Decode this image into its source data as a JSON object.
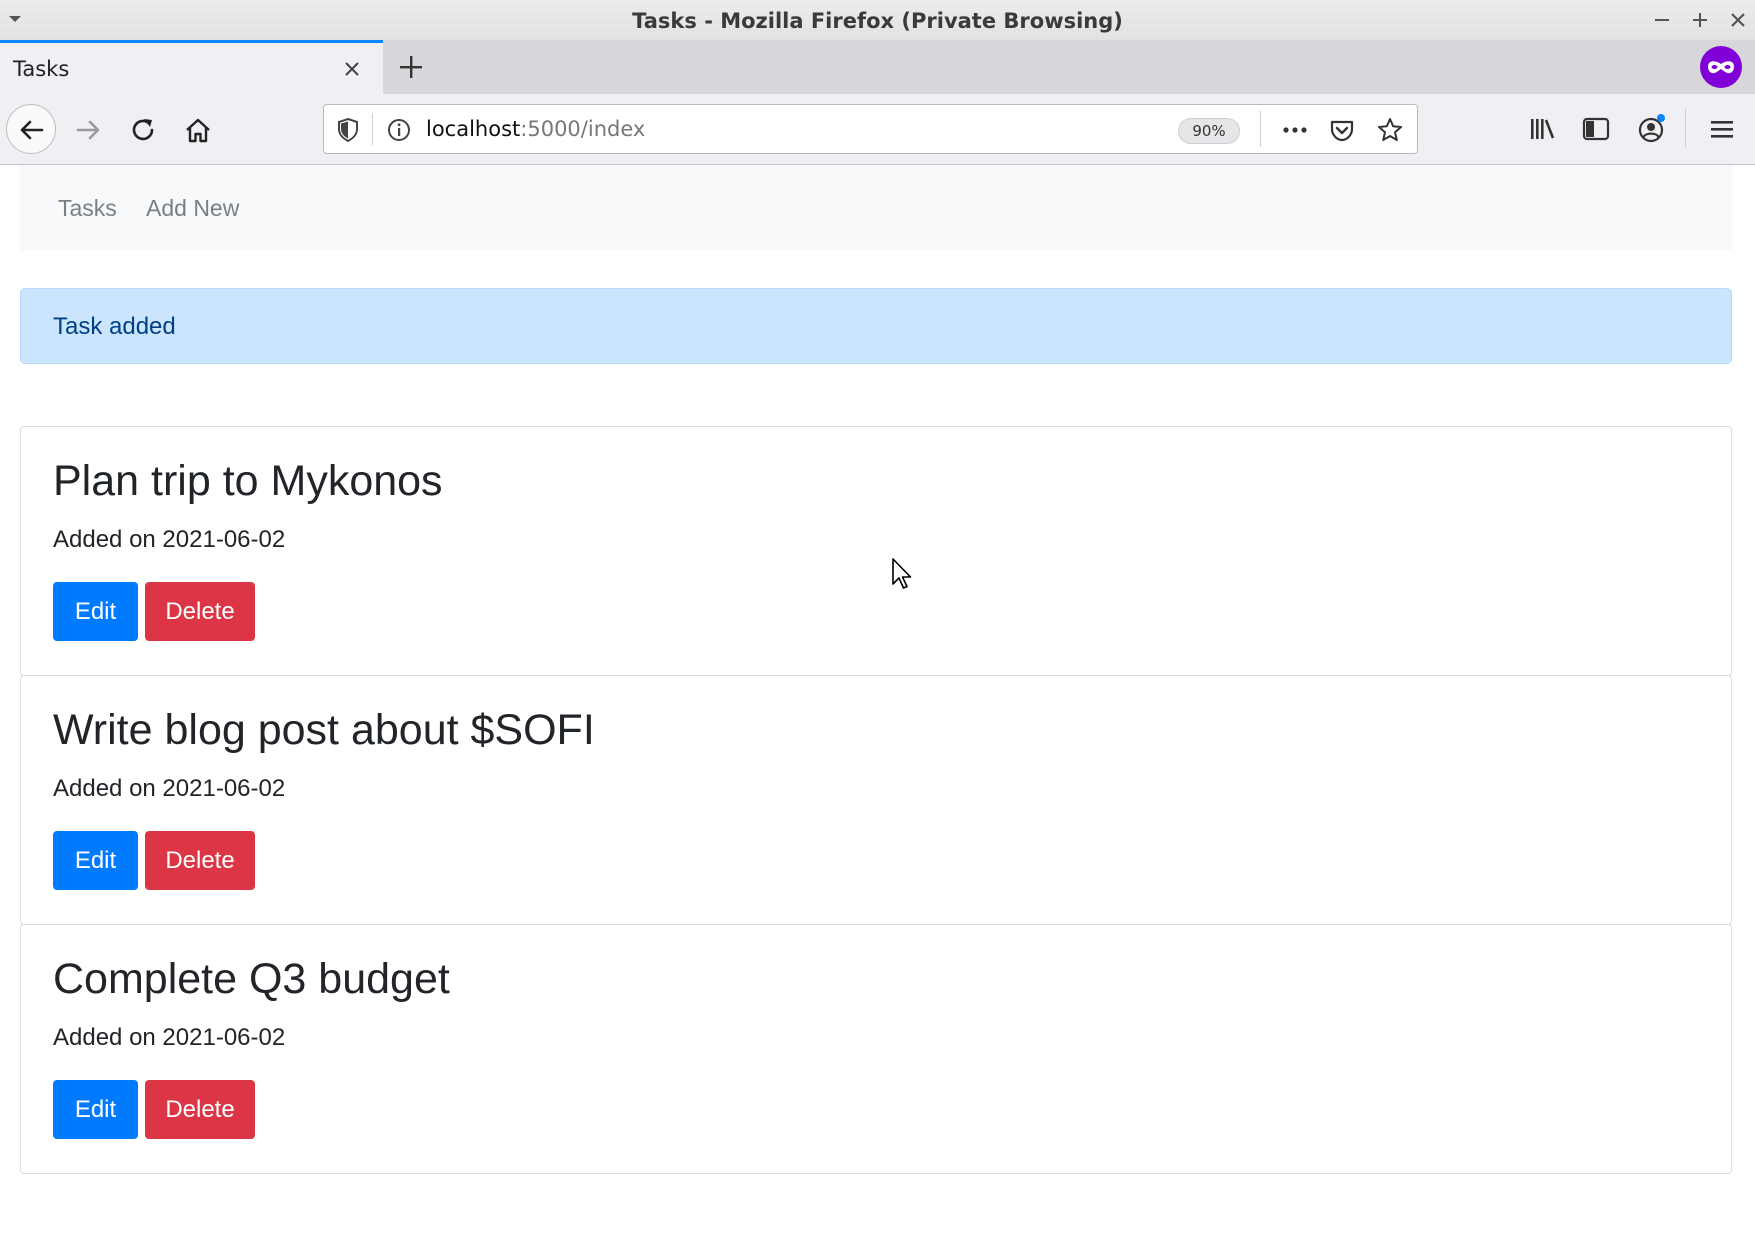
{
  "window": {
    "title": "Tasks - Mozilla Firefox (Private Browsing)"
  },
  "browser": {
    "tab_title": "Tasks",
    "url_host": "localhost",
    "url_path": ":5000/index",
    "zoom": "90%"
  },
  "app": {
    "nav": {
      "tasks_label": "Tasks",
      "add_new_label": "Add New"
    },
    "alert": "Task added",
    "tasks": [
      {
        "title": "Plan trip to Mykonos",
        "date": "Added on 2021-06-02",
        "edit_label": "Edit",
        "delete_label": "Delete"
      },
      {
        "title": "Write blog post about $SOFI",
        "date": "Added on 2021-06-02",
        "edit_label": "Edit",
        "delete_label": "Delete"
      },
      {
        "title": "Complete Q3 budget",
        "date": "Added on 2021-06-02",
        "edit_label": "Edit",
        "delete_label": "Delete"
      }
    ]
  },
  "colors": {
    "primary": "#007bff",
    "danger": "#dc3545",
    "alert_bg": "#cce5ff",
    "alert_text": "#004085",
    "private_purple": "#8000d7",
    "tab_accent": "#0a84ff"
  }
}
